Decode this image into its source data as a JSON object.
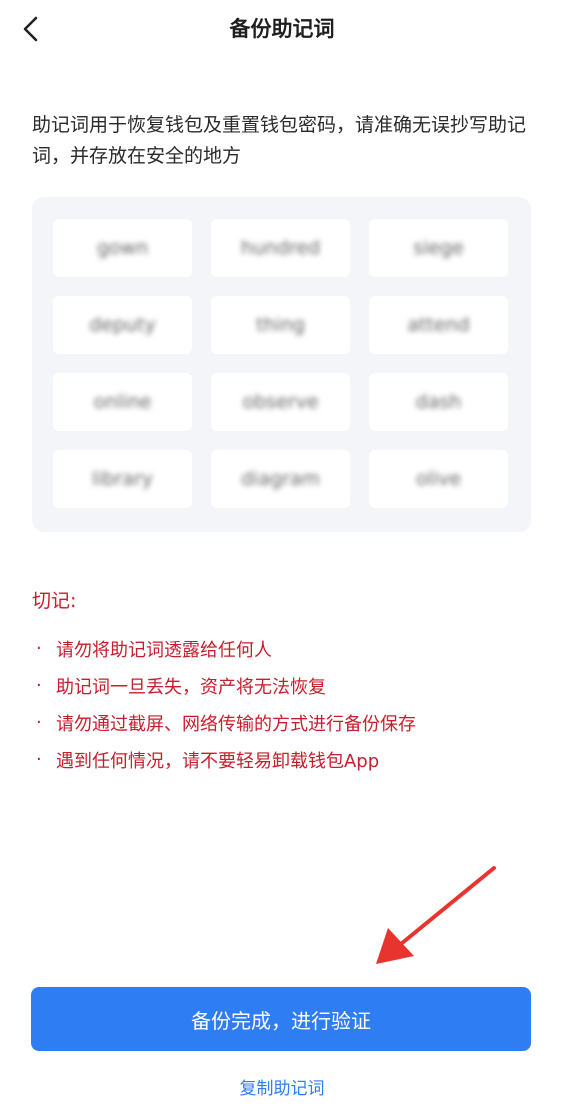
{
  "header": {
    "back_icon": "chevron-left-icon",
    "title": "备份助记词"
  },
  "intro": {
    "text": "助记词用于恢复钱包及重置钱包密码，请准确无误抄写助记词，并存放在安全的地方"
  },
  "mnemonic": {
    "words": [
      "gown",
      "hundred",
      "siege",
      "deputy",
      "thing",
      "attend",
      "online",
      "observe",
      "dash",
      "library",
      "diagram",
      "olive"
    ]
  },
  "warning": {
    "title": "切记:",
    "items": [
      "请勿将助记词透露给任何人",
      "助记词一旦丢失，资产将无法恢复",
      "请勿通过截屏、网络传输的方式进行备份保存",
      "遇到任何情况，请不要轻易卸载钱包App"
    ],
    "bullet": "·"
  },
  "actions": {
    "primary_label": "备份完成，进行验证",
    "copy_label": "复制助记词"
  },
  "colors": {
    "accent": "#2f7df3",
    "warning": "#c81d2c",
    "grid_bg": "#f4f5f8",
    "annotation_arrow": "#e8342f"
  }
}
